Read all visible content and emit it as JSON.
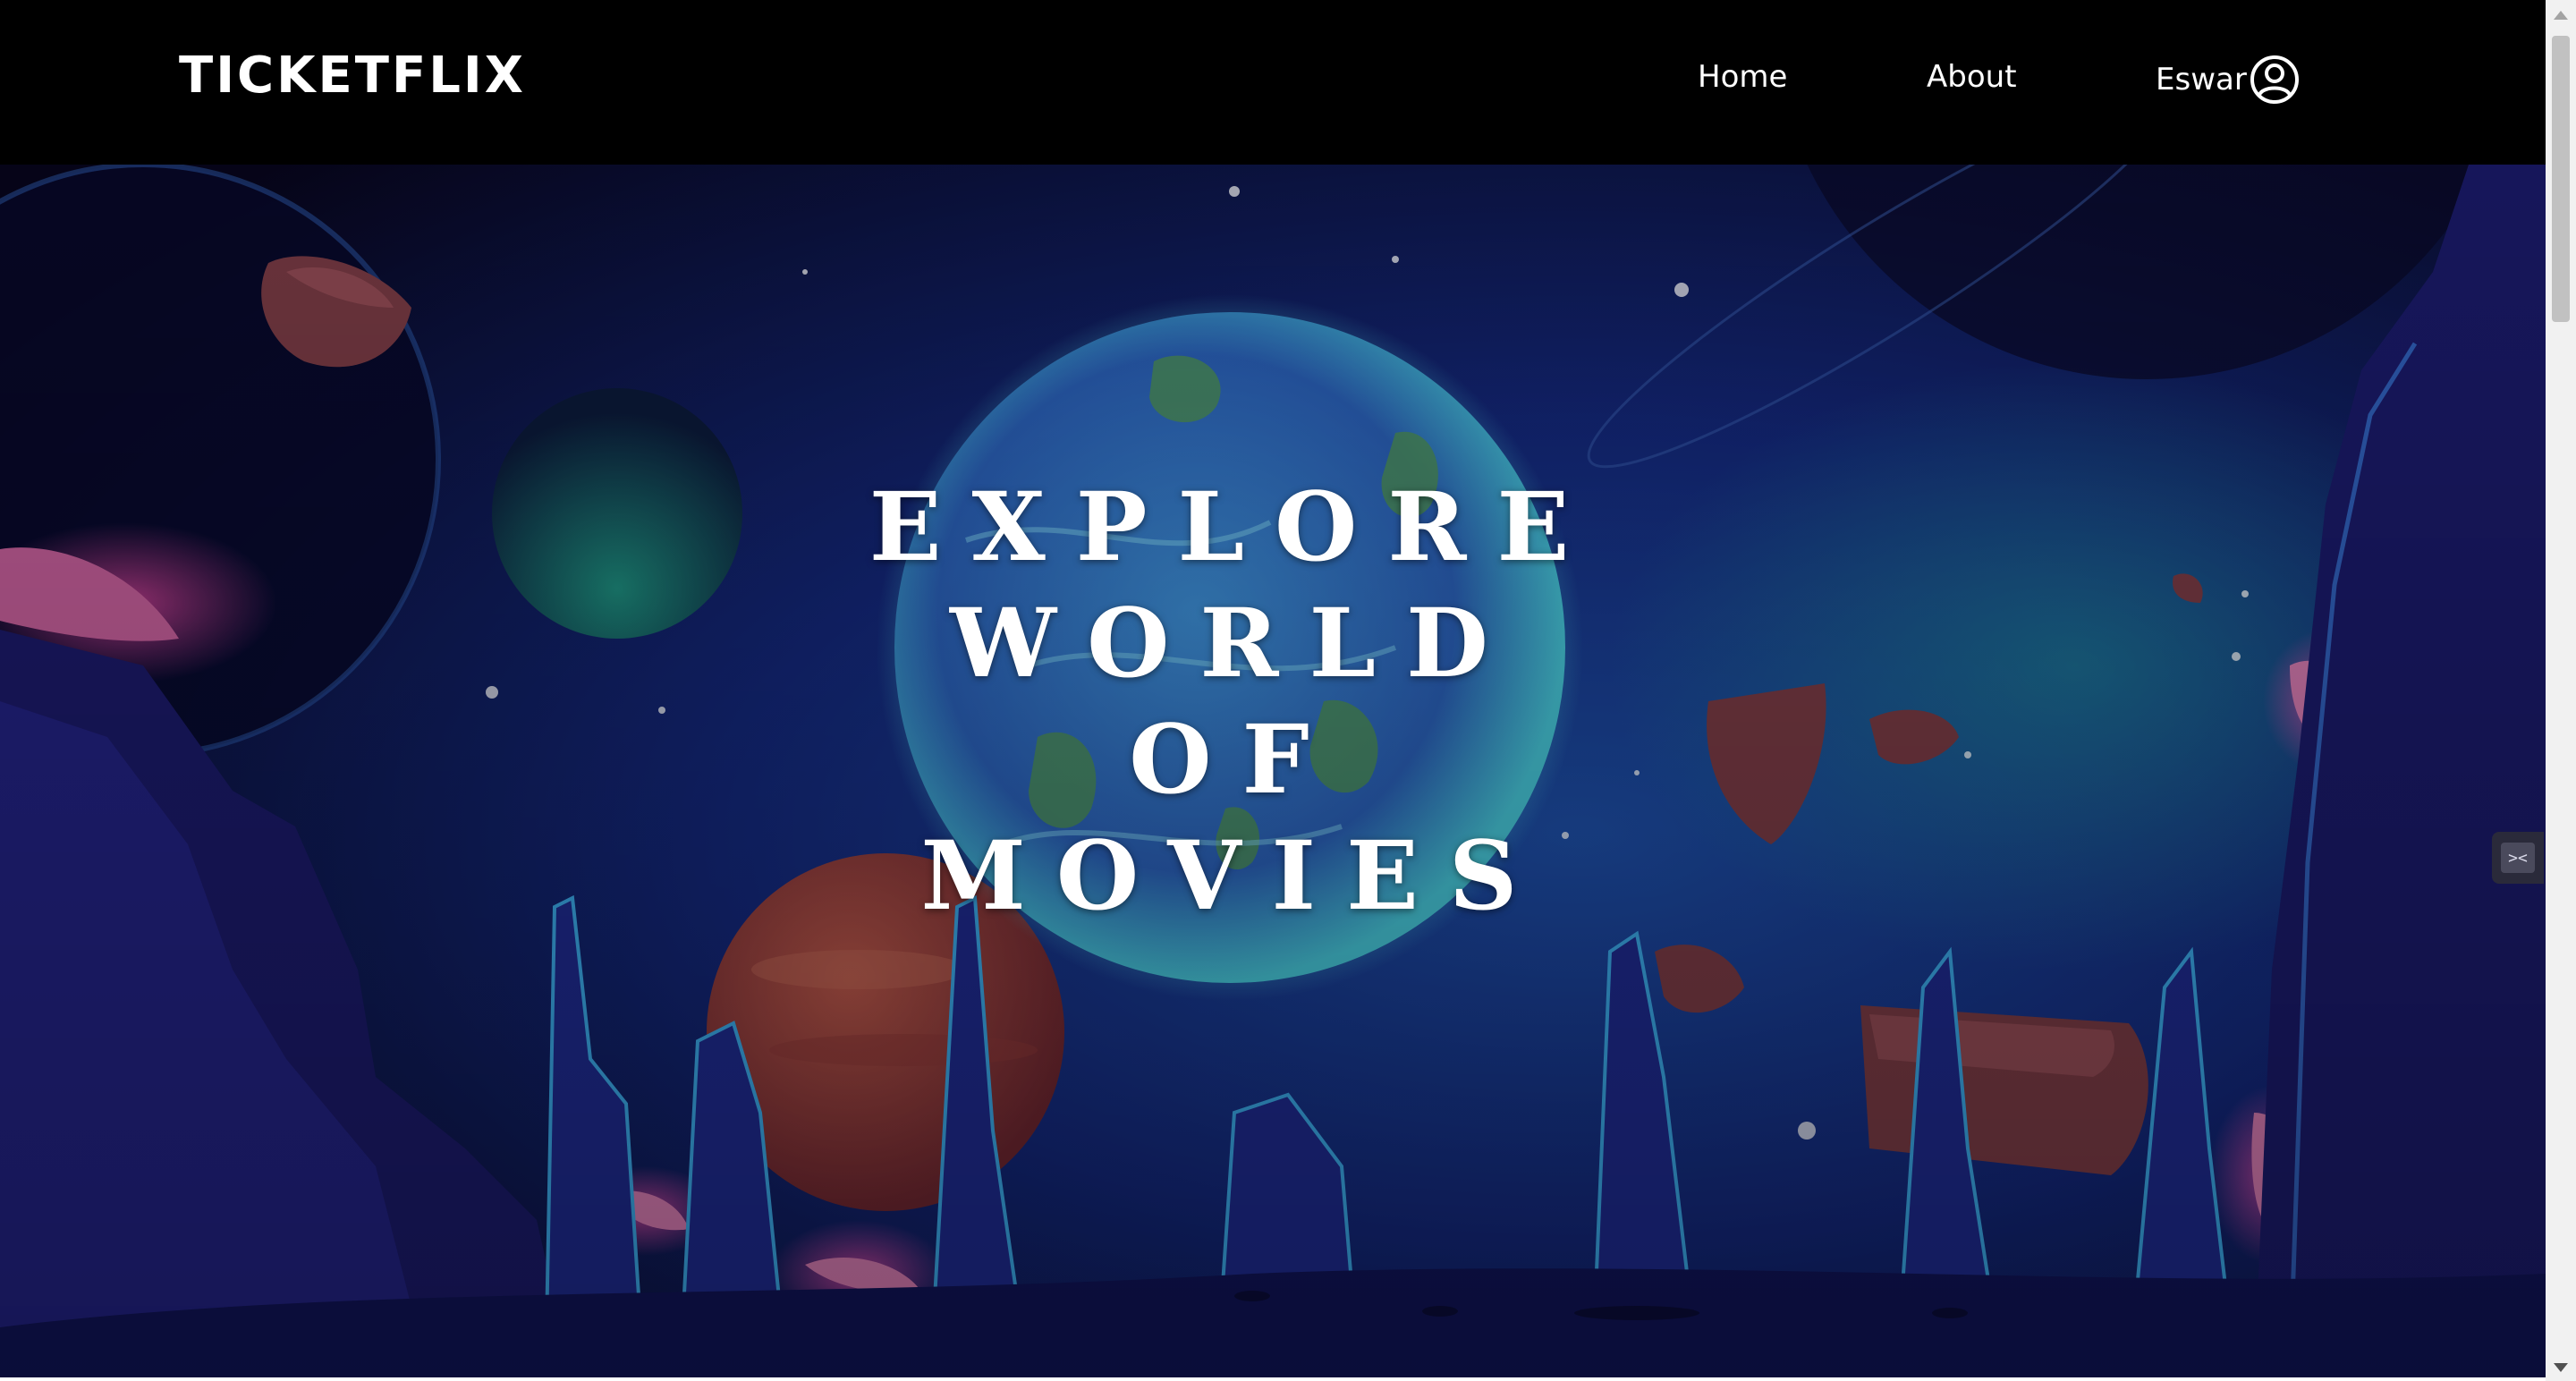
{
  "navbar": {
    "brand": "TICKETFLIX",
    "links": [
      {
        "label": "Home"
      },
      {
        "label": "About"
      }
    ],
    "user": {
      "label": "Eswar",
      "icon": "user-circle-icon"
    }
  },
  "hero": {
    "headline_lines": [
      "EXPLORE",
      "WORLD",
      "OF",
      "MOVIES"
    ]
  },
  "side_widget": {
    "icon": "extension-icon",
    "glyph": "><"
  },
  "colors": {
    "nav_background": "#000000",
    "text": "#ffffff",
    "sky_dark": "#0b0a2e",
    "sky_mid": "#16267a",
    "planet_blue": "#2f8fd1",
    "planet_red": "#a8443a",
    "scrollbar_track": "#f1f1f1",
    "scrollbar_thumb": "#c1c1c1"
  }
}
